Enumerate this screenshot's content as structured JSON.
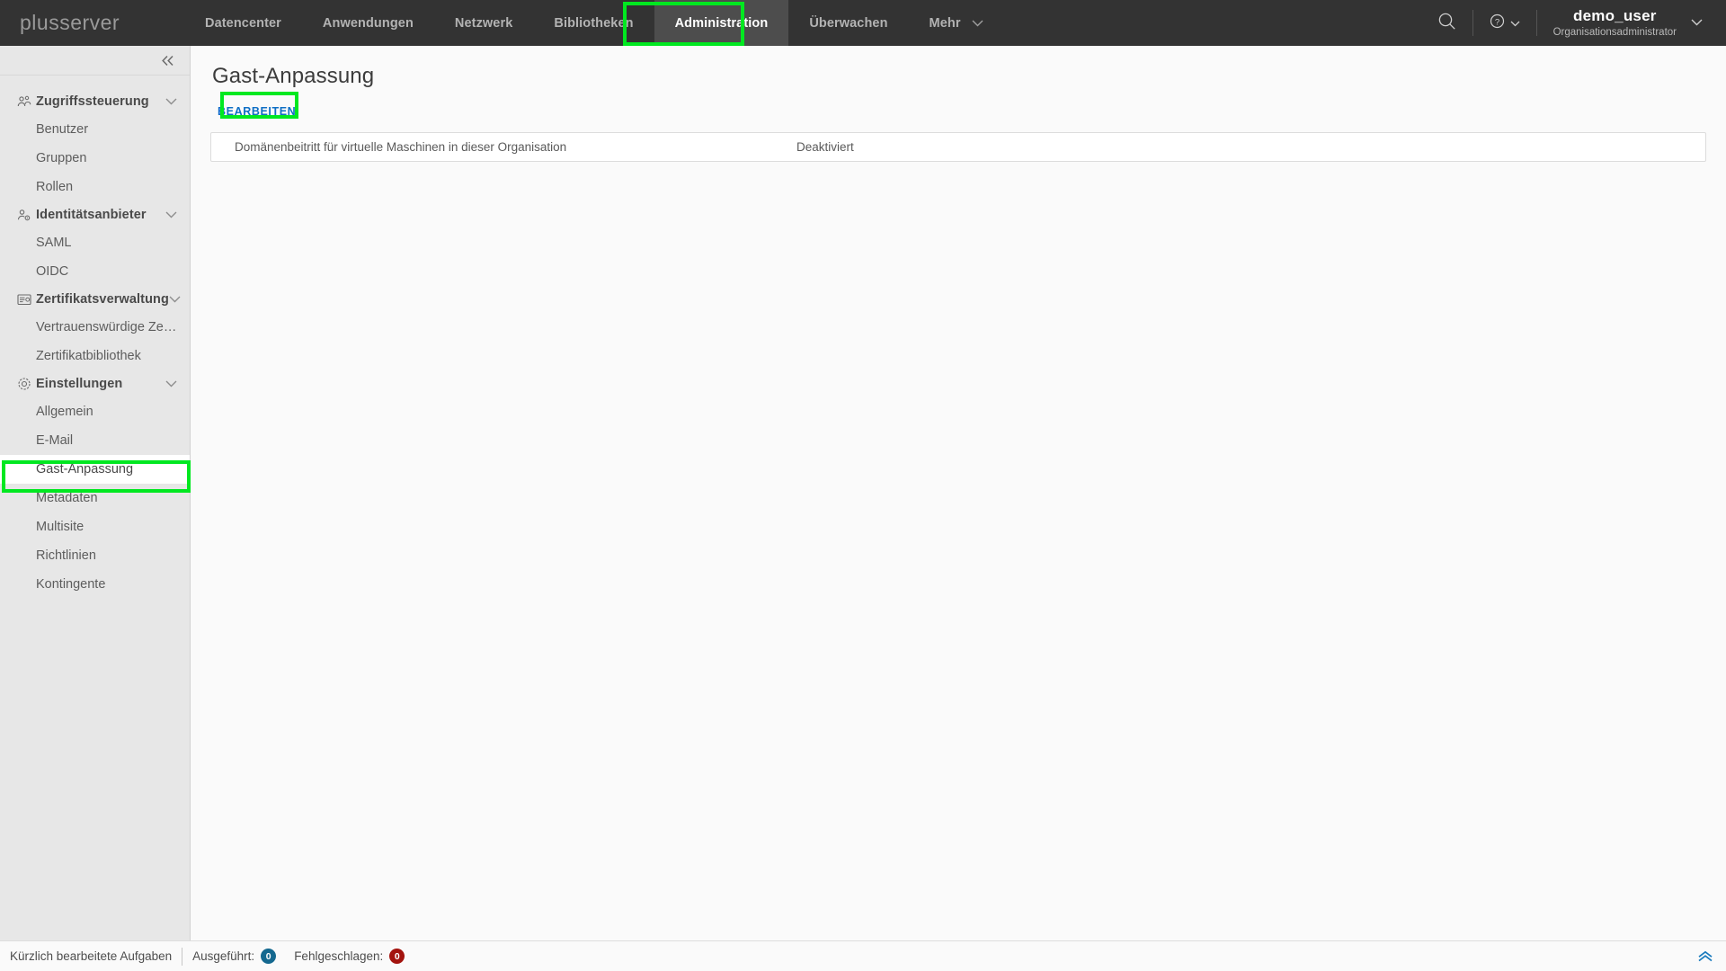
{
  "brand": {
    "name": "plusserver"
  },
  "topnav": {
    "items": [
      {
        "label": "Datencenter",
        "active": false,
        "caret": false
      },
      {
        "label": "Anwendungen",
        "active": false,
        "caret": false
      },
      {
        "label": "Netzwerk",
        "active": false,
        "caret": false
      },
      {
        "label": "Bibliotheken",
        "active": false,
        "caret": false
      },
      {
        "label": "Administration",
        "active": true,
        "caret": false
      },
      {
        "label": "Überwachen",
        "active": false,
        "caret": false
      },
      {
        "label": "Mehr",
        "active": false,
        "caret": true
      }
    ],
    "search_icon": "search-icon",
    "help_icon": "help-circle-icon",
    "user": {
      "name": "demo_user",
      "role": "Organisationsadministrator"
    }
  },
  "sidebar": {
    "collapse_icon": "double-chevron-left-icon",
    "groups": [
      {
        "label": "Zugriffssteuerung",
        "icon": "users-group-icon",
        "items": [
          {
            "label": "Benutzer",
            "selected": false
          },
          {
            "label": "Gruppen",
            "selected": false
          },
          {
            "label": "Rollen",
            "selected": false
          }
        ]
      },
      {
        "label": "Identitätsanbieter",
        "icon": "user-gear-icon",
        "items": [
          {
            "label": "SAML",
            "selected": false
          },
          {
            "label": "OIDC",
            "selected": false
          }
        ]
      },
      {
        "label": "Zertifikatsverwaltung",
        "icon": "certificate-icon",
        "items": [
          {
            "label": "Vertrauenswürdige Zertifi…",
            "selected": false
          },
          {
            "label": "Zertifikatbibliothek",
            "selected": false
          }
        ]
      },
      {
        "label": "Einstellungen",
        "icon": "gear-icon",
        "items": [
          {
            "label": "Allgemein",
            "selected": false
          },
          {
            "label": "E-Mail",
            "selected": false
          },
          {
            "label": "Gast-Anpassung",
            "selected": true
          },
          {
            "label": "Metadaten",
            "selected": false
          },
          {
            "label": "Multisite",
            "selected": false
          },
          {
            "label": "Richtlinien",
            "selected": false
          },
          {
            "label": "Kontingente",
            "selected": false
          }
        ]
      }
    ]
  },
  "main": {
    "title": "Gast-Anpassung",
    "edit_label": "BEARBEITEN",
    "row": {
      "label": "Domänenbeitritt für virtuelle Maschinen in dieser Organisation",
      "value": "Deaktiviert"
    }
  },
  "footer": {
    "tasks_label": "Kürzlich bearbeitete Aufgaben",
    "running_label": "Ausgeführt:",
    "running_count": "0",
    "failed_label": "Fehlgeschlagen:",
    "failed_count": "0",
    "collapse_icon": "double-chevron-up-icon"
  },
  "colors": {
    "nav_bg": "#333333",
    "nav_active_bg": "#4d4d4d",
    "sidebar_bg": "#e7e7e7",
    "accent_link": "#0f6fc5",
    "annotation": "#00e820",
    "badge_ok": "#14688f",
    "badge_fail": "#a3130e"
  }
}
